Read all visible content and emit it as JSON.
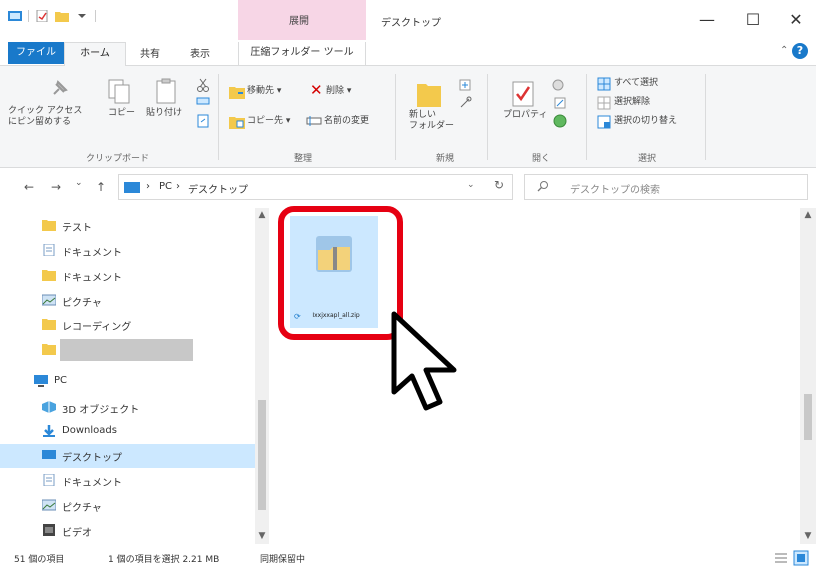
{
  "titlebar": {
    "context_group": "展開",
    "title": "デスクトップ",
    "minimize": "—",
    "maximize": "☐",
    "close": "✕"
  },
  "ribbon_tabs": {
    "file": "ファイル",
    "home": "ホーム",
    "share": "共有",
    "view": "表示",
    "compressed_tools": "圧縮フォルダー ツール",
    "collapse": "⌃",
    "help": "?"
  },
  "ribbon": {
    "clipboard": {
      "label": "クリップボード",
      "pin_quick_access": "クイック アクセス\nにピン留めする",
      "copy": "コピー",
      "paste": "貼り付け"
    },
    "organize": {
      "label": "整理",
      "move_to": "移動先 ▾",
      "delete": "削除 ▾",
      "copy_to": "コピー先 ▾",
      "rename": "名前の変更"
    },
    "new": {
      "label": "新規",
      "new_folder": "新しい\nフォルダー"
    },
    "open": {
      "label": "開く",
      "properties": "プロパティ"
    },
    "select": {
      "label": "選択",
      "select_all": "すべて選択",
      "select_none": "選択解除",
      "invert_selection": "選択の切り替え"
    }
  },
  "address": {
    "back": "←",
    "forward": "→",
    "recent": "⌄",
    "up": "↑",
    "crumb_sep": "›",
    "crumb_pc": "PC",
    "crumb_desktop": "デスクトップ",
    "dropdown": "⌄",
    "refresh": "↻",
    "search_placeholder": "デスクトップの検索"
  },
  "navpane": {
    "items": [
      {
        "label": "テスト",
        "icon": "folder-icon"
      },
      {
        "label": "ドキュメント",
        "icon": "document-icon"
      },
      {
        "label": "ドキュメント",
        "icon": "folder-icon"
      },
      {
        "label": "ピクチャ",
        "icon": "pictures-icon"
      },
      {
        "label": "レコーディング",
        "icon": "folder-icon"
      },
      {
        "label": "",
        "icon": "folder-icon"
      },
      {
        "label": "PC",
        "icon": "pc-icon"
      },
      {
        "label": "3D オブジェクト",
        "icon": "3d-objects-icon"
      },
      {
        "label": "Downloads",
        "icon": "downloads-icon"
      },
      {
        "label": "デスクトップ",
        "icon": "desktop-icon"
      },
      {
        "label": "ドキュメント",
        "icon": "document-icon"
      },
      {
        "label": "ピクチャ",
        "icon": "pictures-icon"
      },
      {
        "label": "ビデオ",
        "icon": "video-icon"
      }
    ],
    "selected_index": 9
  },
  "content": {
    "file_name": "Ixxjxxapl_all.zip"
  },
  "status": {
    "item_count": "51 個の項目",
    "selected": "1 個の項目を選択 2.21 MB",
    "sync": "同期保留中"
  },
  "colors": {
    "accent": "#1979ca",
    "selection": "#cce8ff",
    "highlight": "#e60012",
    "context_tab": "#f7d6e6"
  }
}
